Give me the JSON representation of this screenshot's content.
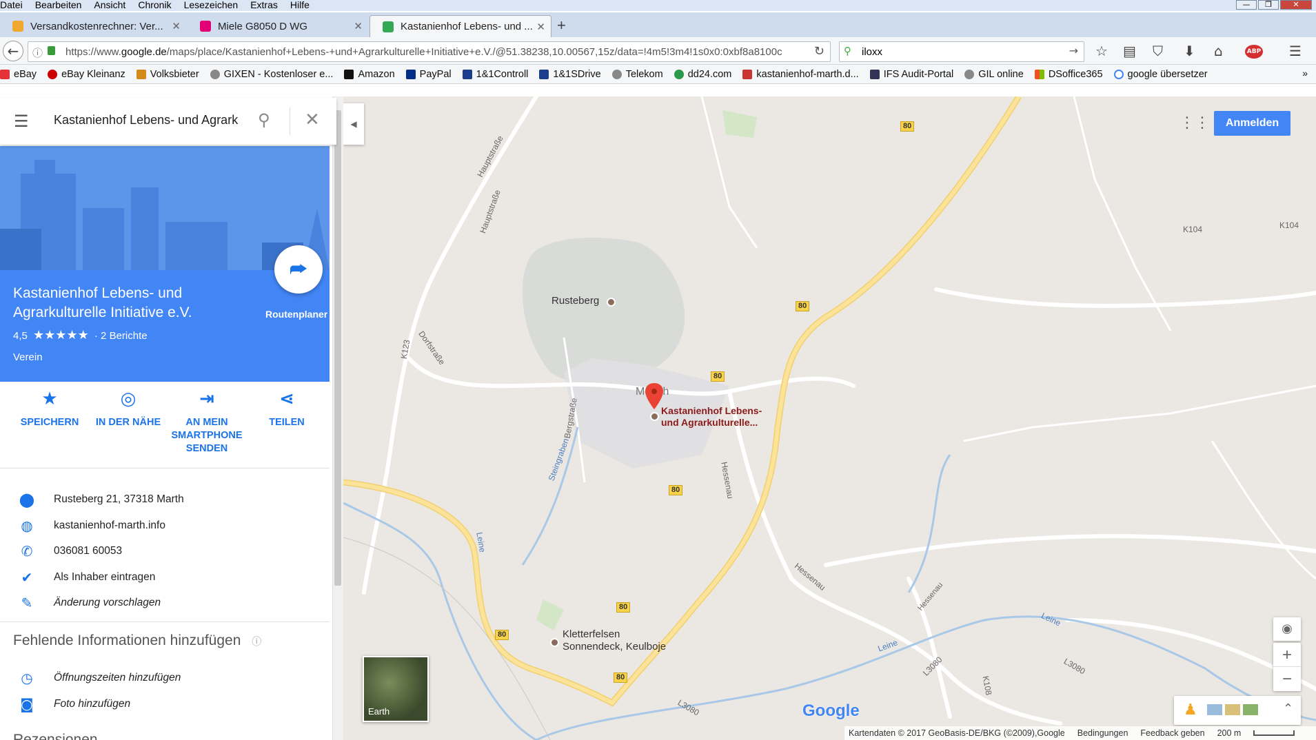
{
  "menu": [
    "Datei",
    "Bearbeiten",
    "Ansicht",
    "Chronik",
    "Lesezeichen",
    "Extras",
    "Hilfe"
  ],
  "tabs": [
    {
      "title": "Versandkostenrechner: Ver...",
      "color": "#f0a830"
    },
    {
      "title": "Miele G8050 D WG",
      "color": "#e20074"
    },
    {
      "title": "Kastanienhof Lebens- und ...",
      "color": "#34a853"
    }
  ],
  "url": {
    "prefix": "https://www.",
    "domain": "google.de",
    "rest": "/maps/place/Kastanienhof+Lebens-+und+Agrarkulturelle+Initiative+e.V./@51.38238,10.00567,15z/data=!4m5!3m4!1s0x0:0xbf8a8100c"
  },
  "search_value": "iloxx",
  "bookmarks": [
    "eBay",
    "eBay Kleinanz",
    "Volksbieter",
    "GIXEN - Kostenloser e...",
    "Amazon",
    "PayPal",
    "1&1Controll",
    "1&1SDrive",
    "Telekom",
    "dd24.com",
    "kastanienhof-marth.d...",
    "IFS Audit-Portal",
    "GIL online",
    "DSoffice365",
    "google übersetzer"
  ],
  "panel": {
    "search_value": "Kastanienhof Lebens- und Agrark",
    "place_name_1": "Kastanienhof Lebens- und",
    "place_name_2": "Agrarkulturelle Initiative e.V.",
    "rating": "4,5",
    "stars": "★★★★★",
    "reviews": "· 2 Berichte",
    "category": "Verein",
    "route_label": "Routenplaner",
    "actions": [
      {
        "icon": "star-icon",
        "glyph": "★",
        "label": "SPEICHERN"
      },
      {
        "icon": "nearby-icon",
        "glyph": "◎",
        "label": "IN DER NÄHE"
      },
      {
        "icon": "send-to-phone-icon",
        "glyph": "⇥",
        "label": "AN MEIN SMARTPHONE SENDEN"
      },
      {
        "icon": "share-icon",
        "glyph": "⋖",
        "label": "TEILEN"
      }
    ],
    "info": [
      {
        "icon": "pin-icon",
        "glyph": "⬤",
        "text": "Rusteberg 21, 37318 Marth"
      },
      {
        "icon": "globe-icon",
        "glyph": "◍",
        "text": "kastanienhof-marth.info"
      },
      {
        "icon": "phone-icon",
        "glyph": "✆",
        "text": "036081 60053"
      },
      {
        "icon": "verified-icon",
        "glyph": "✔",
        "text": "Als Inhaber eintragen"
      },
      {
        "icon": "edit-icon",
        "glyph": "✎",
        "text": "Änderung vorschlagen"
      }
    ],
    "missing_heading": "Fehlende Informationen hinzufügen",
    "missing": [
      {
        "icon": "clock-icon",
        "glyph": "◷",
        "text": "Öffnungszeiten hinzufügen"
      },
      {
        "icon": "camera-icon",
        "glyph": "◙",
        "text": "Foto hinzufügen"
      }
    ],
    "more_heading": "Rezensionen"
  },
  "map": {
    "signin": "Anmelden",
    "labels": {
      "rusteberg": "Rusteberg",
      "marth": "M  rth",
      "place_line1": "Kastanienhof Lebens-",
      "place_line2": "und Agrarkulturelle...",
      "kletter1": "Kletterfelsen",
      "kletter2": "Sonnendeck, Keulboje",
      "hauptstrasse": "Hauptstraße",
      "dorfstrasse": "Dorfstraße",
      "bergstrasse": "Bergstraße",
      "steingraben": "Steingraben",
      "hessenau": "Hessenau",
      "leine": "Leine",
      "k123": "K123",
      "k104": "K104",
      "k108": "K108",
      "l3080": "L3080",
      "earth": "Earth",
      "google": "Google"
    },
    "shield_label": "80",
    "footer": [
      "Kartendaten © 2017 GeoBasis-DE/BKG (©2009),Google",
      "Bedingungen",
      "Feedback geben",
      "200 m"
    ]
  }
}
